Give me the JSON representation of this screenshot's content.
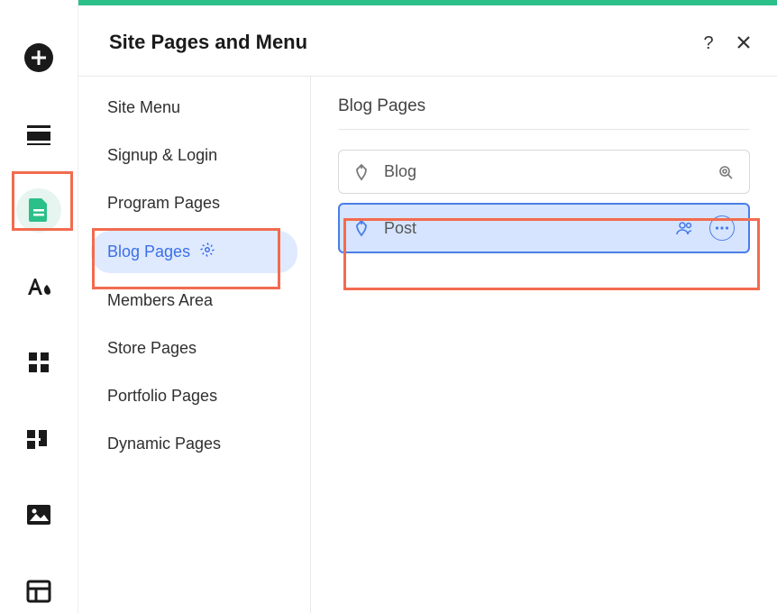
{
  "header": {
    "title": "Site Pages and Menu"
  },
  "menu": {
    "items": [
      {
        "label": "Site Menu"
      },
      {
        "label": "Signup & Login"
      },
      {
        "label": "Program Pages"
      },
      {
        "label": "Blog Pages"
      },
      {
        "label": "Members Area"
      },
      {
        "label": "Store Pages"
      },
      {
        "label": "Portfolio Pages"
      },
      {
        "label": "Dynamic Pages"
      }
    ]
  },
  "content": {
    "section_title": "Blog Pages",
    "pages": [
      {
        "label": "Blog"
      },
      {
        "label": "Post"
      }
    ]
  }
}
